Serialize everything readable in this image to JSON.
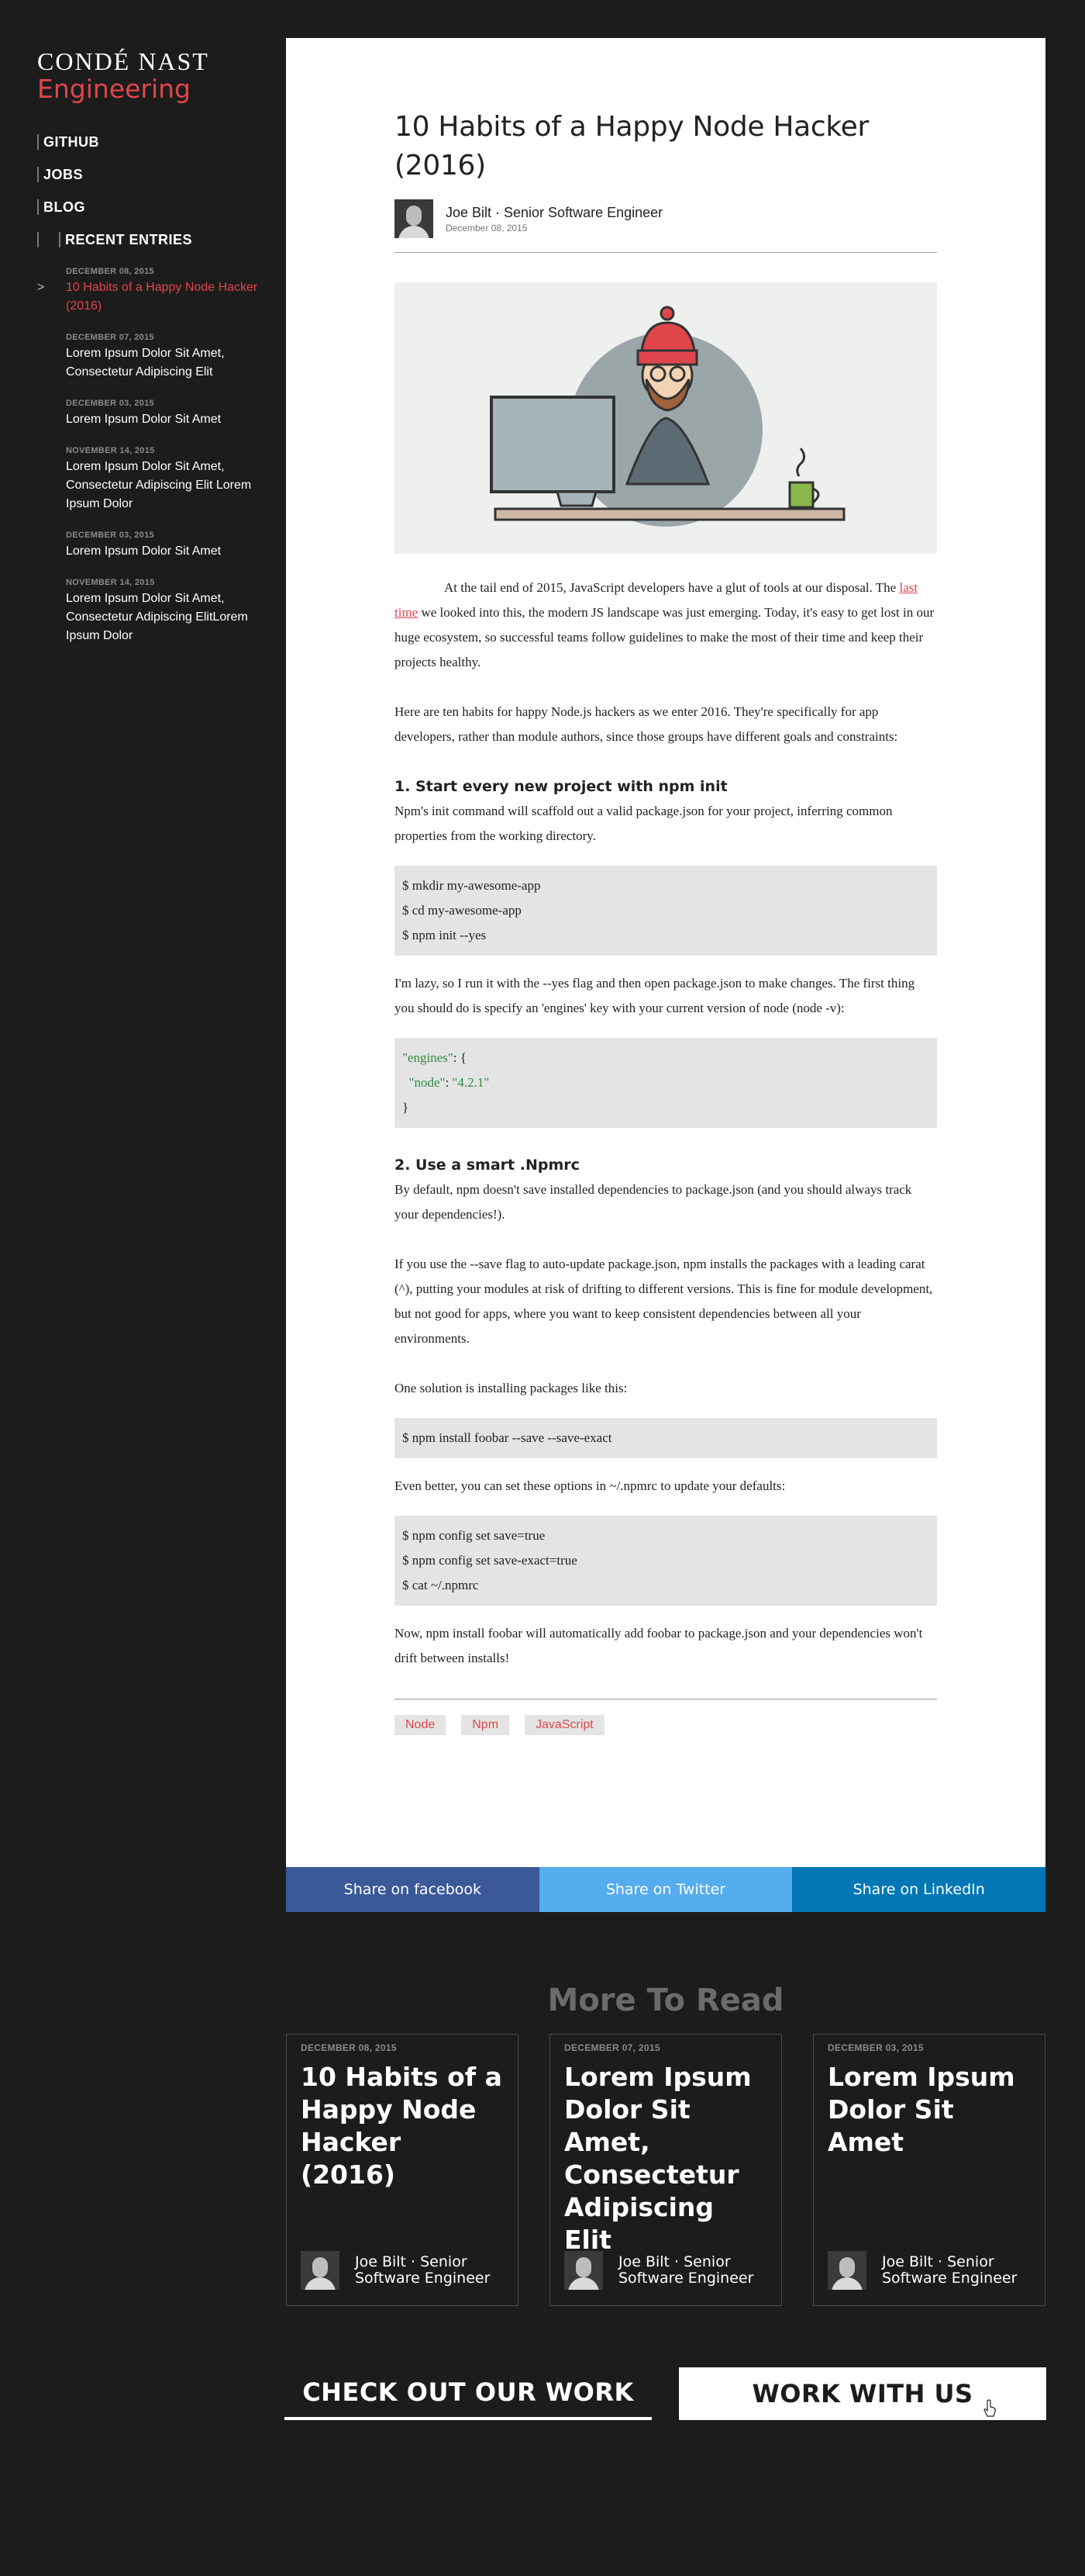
{
  "sidebar": {
    "brand_top": "CONDÉ  NAST",
    "brand_bottom": "Engineering",
    "nav": [
      "GITHUB",
      "JOBS",
      "BLOG"
    ],
    "recent_label": "RECENT ENTRIES",
    "entries": [
      {
        "date": "DECEMBER 08, 2015",
        "title": "10 Habits of a Happy Node Hacker (2016)",
        "active": true
      },
      {
        "date": "DECEMBER 07, 2015",
        "title": "Lorem Ipsum Dolor Sit Amet, Consectetur Adipiscing Elit"
      },
      {
        "date": "DECEMBER 03, 2015",
        "title": "Lorem Ipsum Dolor Sit Amet"
      },
      {
        "date": "NOVEMBER 14, 2015",
        "title": "Lorem Ipsum Dolor Sit Amet, Consectetur Adipiscing Elit Lorem Ipsum Dolor"
      },
      {
        "date": "DECEMBER 03, 2015",
        "title": "Lorem Ipsum Dolor Sit Amet"
      },
      {
        "date": "NOVEMBER 14, 2015",
        "title": "Lorem Ipsum Dolor Sit Amet, Consectetur Adipiscing ElitLorem Ipsum Dolor"
      }
    ],
    "arrow": ">"
  },
  "article": {
    "title": "10 Habits of a Happy Node Hacker (2016)",
    "author": "Joe Bilt · Senior Software Engineer",
    "date": "December 08, 2015",
    "p1_before": "At the tail end of 2015, JavaScript developers have a glut of tools at our disposal. The ",
    "p1_link": "last time",
    "p1_after": " we looked into this, the modern JS landscape was just emerging. Today, it's easy to get lost in our huge ecosystem, so successful teams follow guidelines to make the most of their time and keep their projects healthy.",
    "p2": "Here are ten habits for happy Node.js hackers as we enter 2016. They're specifically for app developers, rather than module authors, since those groups have different goals and constraints:",
    "h1": "1. Start every new project with npm init",
    "p3": "Npm's init command will scaffold out a valid package.json for your project, inferring common properties from the working directory.",
    "code1": [
      "$ mkdir my-awesome-app",
      "$ cd my-awesome-app",
      "$ npm init --yes"
    ],
    "p4": "I'm lazy, so I run it with the --yes flag and then open package.json to make changes. The first thing you should do is specify an 'engines' key with your current version of node (node -v):",
    "code2_l1_key": "\"engines\"",
    "code2_l1_rest": ": {",
    "code2_l2_key": "\"node\"",
    "code2_l2_sep": ": ",
    "code2_l2_val": "\"4.2.1\"",
    "code2_l3": "}",
    "h2": "2. Use a smart .Npmrc",
    "p5": "By default, npm doesn't save installed dependencies to package.json (and you should always track your dependencies!).",
    "p6": "If you use the --save flag to auto-update package.json, npm installs the packages with a leading carat (^), putting your modules at risk of drifting to different versions. This is fine for module development, but not good for apps, where you want to keep consistent dependencies between all your environments.",
    "p7": "One solution is installing packages like this:",
    "code3": [
      "$ npm install foobar --save --save-exact"
    ],
    "p8": "Even better, you can set these options in ~/.npmrc to update your defaults:",
    "code4": [
      "$ npm config set save=true",
      "$ npm config set save-exact=true",
      "$ cat ~/.npmrc"
    ],
    "p9": "Now, npm install foobar will automatically add foobar to package.json and your dependencies won't drift between installs!",
    "tags": [
      "Node",
      "Npm",
      "JavaScript"
    ]
  },
  "share": {
    "facebook": "Share on facebook",
    "twitter": "Share on Twitter",
    "linkedin": "Share on LinkedIn"
  },
  "more": {
    "title": "More To Read",
    "cards": [
      {
        "date": "DECEMBER 08, 2015",
        "title": "10 Habits of a Happy Node Hacker (2016)",
        "author": "Joe Bilt · Senior Software Engineer"
      },
      {
        "date": "DECEMBER 07, 2015",
        "title": "Lorem Ipsum Dolor Sit Amet, Consectetur Adipiscing Elit",
        "author": "Joe Bilt · Senior Software Engineer"
      },
      {
        "date": "DECEMBER 03, 2015",
        "title": "Lorem Ipsum Dolor Sit Amet",
        "author": "Joe Bilt · Senior Software Engineer"
      }
    ]
  },
  "cta": {
    "work": "CHECK OUT OUR WORK",
    "with_us": "WORK WITH US"
  },
  "colors": {
    "accent": "#e0454c",
    "background": "#1c1c1c",
    "facebook": "#3b5998",
    "twitter": "#55acee",
    "linkedin": "#0077b5",
    "code_bg": "#e4e4e4"
  }
}
